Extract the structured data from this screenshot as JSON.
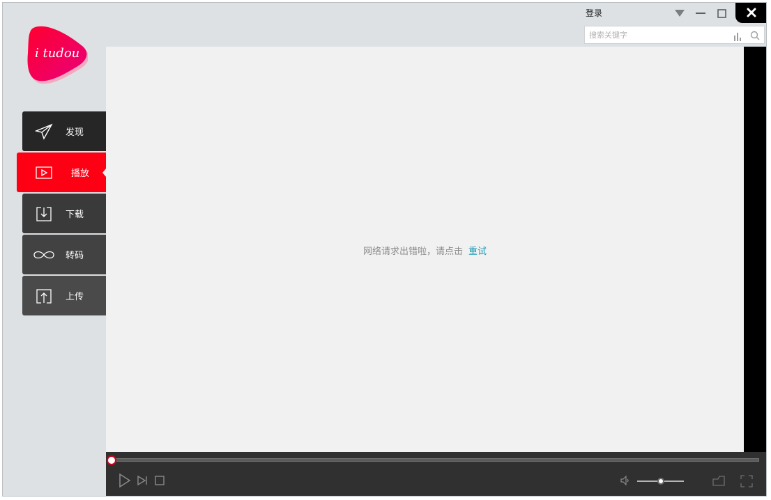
{
  "app": {
    "logo_text": "i tudou"
  },
  "titlebar": {
    "login_label": "登录"
  },
  "search": {
    "placeholder": "搜索关键字",
    "value": ""
  },
  "sidebar": {
    "items": [
      {
        "label": "发现",
        "icon": "send-icon",
        "active": false
      },
      {
        "label": "播放",
        "icon": "play-square-icon",
        "active": true
      },
      {
        "label": "下载",
        "icon": "download-icon",
        "active": false
      },
      {
        "label": "转码",
        "icon": "infinity-icon",
        "active": false
      },
      {
        "label": "上传",
        "icon": "upload-icon",
        "active": false
      }
    ]
  },
  "content": {
    "error_text": "网络请求出错啦，请点击",
    "retry_label": "重试"
  },
  "player": {
    "progress": 0,
    "volume": 0.5
  },
  "colors": {
    "accent": "#fe0014",
    "link": "#1a9bb5",
    "sidebar_dark": "#2b2b2b",
    "player_bg": "#303030"
  }
}
